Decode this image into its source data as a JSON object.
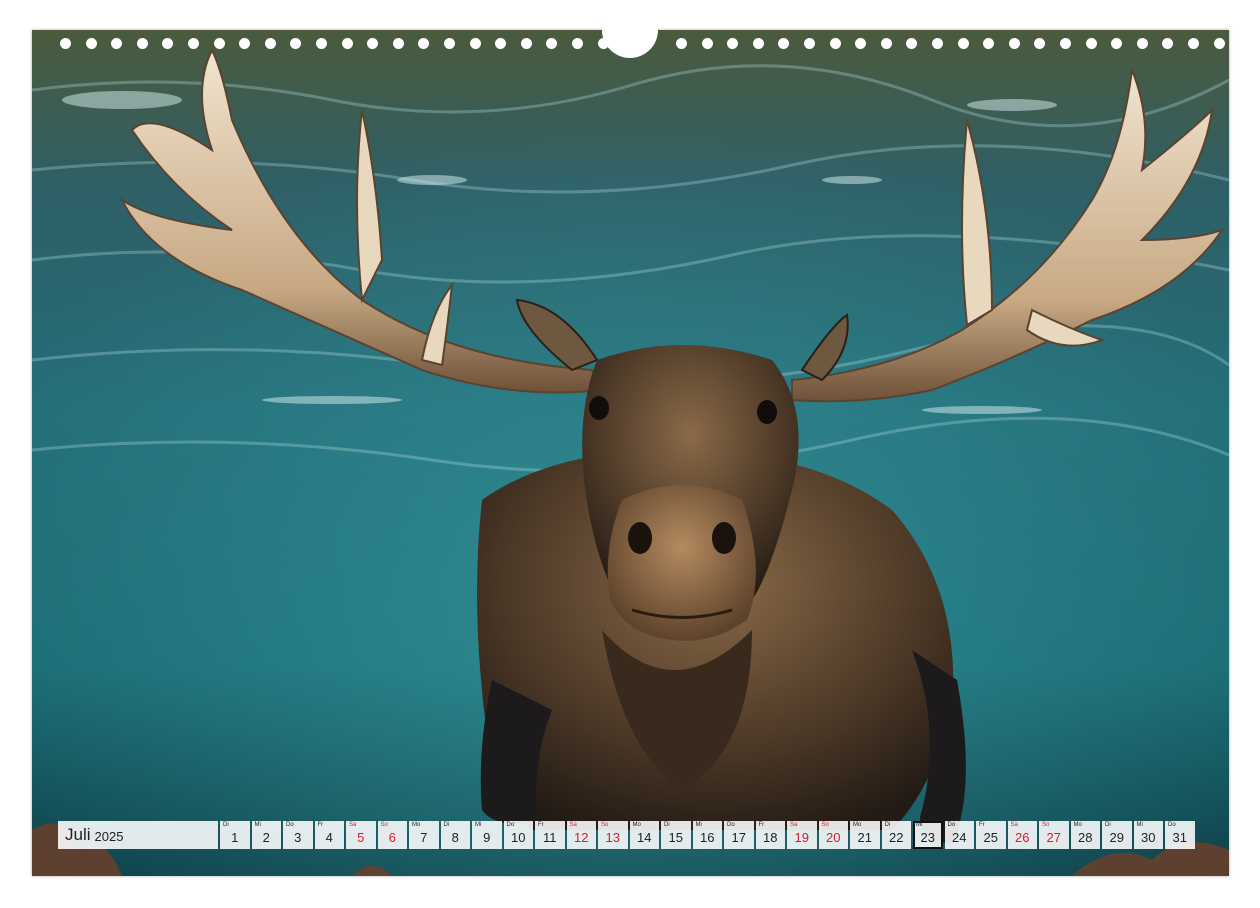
{
  "calendar": {
    "month": "Juli",
    "year": "2025",
    "days": [
      {
        "wd": "Di",
        "num": "1",
        "weekend": false
      },
      {
        "wd": "Mi",
        "num": "2",
        "weekend": false
      },
      {
        "wd": "Do",
        "num": "3",
        "weekend": false
      },
      {
        "wd": "Fr",
        "num": "4",
        "weekend": false
      },
      {
        "wd": "Sa",
        "num": "5",
        "weekend": true
      },
      {
        "wd": "So",
        "num": "6",
        "weekend": true
      },
      {
        "wd": "Mo",
        "num": "7",
        "weekend": false
      },
      {
        "wd": "Di",
        "num": "8",
        "weekend": false
      },
      {
        "wd": "Mi",
        "num": "9",
        "weekend": false
      },
      {
        "wd": "Do",
        "num": "10",
        "weekend": false
      },
      {
        "wd": "Fr",
        "num": "11",
        "weekend": false
      },
      {
        "wd": "Sa",
        "num": "12",
        "weekend": true
      },
      {
        "wd": "So",
        "num": "13",
        "weekend": true
      },
      {
        "wd": "Mo",
        "num": "14",
        "weekend": false
      },
      {
        "wd": "Di",
        "num": "15",
        "weekend": false
      },
      {
        "wd": "Mi",
        "num": "16",
        "weekend": false
      },
      {
        "wd": "Do",
        "num": "17",
        "weekend": false
      },
      {
        "wd": "Fr",
        "num": "18",
        "weekend": false
      },
      {
        "wd": "Sa",
        "num": "19",
        "weekend": true
      },
      {
        "wd": "So",
        "num": "20",
        "weekend": true
      },
      {
        "wd": "Mo",
        "num": "21",
        "weekend": false
      },
      {
        "wd": "Di",
        "num": "22",
        "weekend": false
      },
      {
        "wd": "Mi",
        "num": "23",
        "weekend": false,
        "highlighted": true
      },
      {
        "wd": "Do",
        "num": "24",
        "weekend": false
      },
      {
        "wd": "Fr",
        "num": "25",
        "weekend": false
      },
      {
        "wd": "Sa",
        "num": "26",
        "weekend": true
      },
      {
        "wd": "So",
        "num": "27",
        "weekend": true
      },
      {
        "wd": "Mo",
        "num": "28",
        "weekend": false
      },
      {
        "wd": "Di",
        "num": "29",
        "weekend": false
      },
      {
        "wd": "Mi",
        "num": "30",
        "weekend": false
      },
      {
        "wd": "Do",
        "num": "31",
        "weekend": false
      }
    ]
  },
  "colors": {
    "water_top": "#2f5a5e",
    "water_mid": "#1f6f7a",
    "water_deep": "#0f4a55",
    "weekend": "#d0202a",
    "moose_fur": "#5b4430",
    "antler": "#d9c3a4"
  }
}
